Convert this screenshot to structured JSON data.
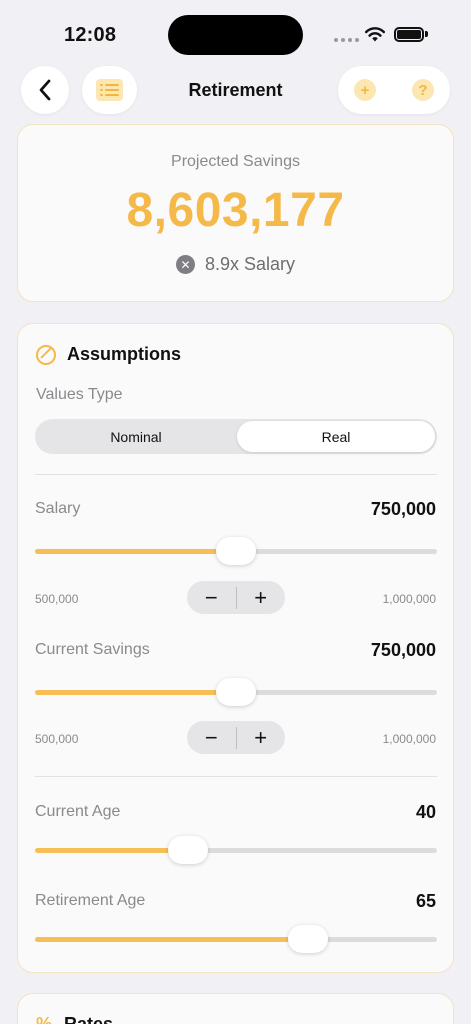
{
  "status": {
    "time": "12:08"
  },
  "nav": {
    "title": "Retirement",
    "add_symbol": "+",
    "help_symbol": "?"
  },
  "projected": {
    "label": "Projected Savings",
    "value": "8,603,177",
    "multiplier": "8.9x Salary"
  },
  "assumptions": {
    "title": "Assumptions",
    "values_type_label": "Values Type",
    "segments": [
      "Nominal",
      "Real"
    ],
    "selected_segment": "Real",
    "salary": {
      "label": "Salary",
      "value": "750,000",
      "min": "500,000",
      "max": "1,000,000",
      "slider_fraction": 0.5
    },
    "current_savings": {
      "label": "Current Savings",
      "value": "750,000",
      "min": "500,000",
      "max": "1,000,000",
      "slider_fraction": 0.5
    },
    "current_age": {
      "label": "Current Age",
      "value": "40",
      "slider_fraction": 0.38
    },
    "retirement_age": {
      "label": "Retirement Age",
      "value": "65",
      "slider_fraction": 0.68
    }
  },
  "stepper": {
    "minus": "−",
    "plus": "+"
  },
  "rates": {
    "title": "Rates",
    "icon": "%"
  },
  "colors": {
    "accent": "#F5B94A",
    "background": "#F1F0F4"
  }
}
